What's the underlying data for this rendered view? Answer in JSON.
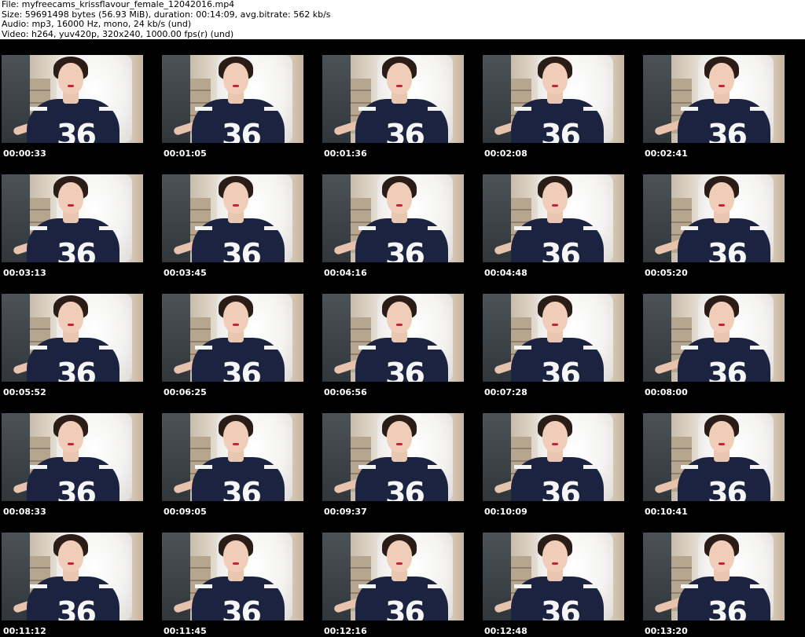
{
  "header": {
    "file": "File: myfreecams_krissflavour_female_12042016.mp4",
    "size": "Size: 59691498 bytes (56.93 MiB), duration: 00:14:09, avg.bitrate: 562 kb/s",
    "audio": "Audio: mp3, 16000 Hz, mono, 24 kb/s (und)",
    "video": "Video: h264, yuv420p, 320x240, 1000.00 fps(r) (und)"
  },
  "thumbnails": [
    {
      "timestamp": "00:00:33"
    },
    {
      "timestamp": "00:01:05"
    },
    {
      "timestamp": "00:01:36"
    },
    {
      "timestamp": "00:02:08"
    },
    {
      "timestamp": "00:02:41"
    },
    {
      "timestamp": "00:03:13"
    },
    {
      "timestamp": "00:03:45"
    },
    {
      "timestamp": "00:04:16"
    },
    {
      "timestamp": "00:04:48"
    },
    {
      "timestamp": "00:05:20"
    },
    {
      "timestamp": "00:05:52"
    },
    {
      "timestamp": "00:06:25"
    },
    {
      "timestamp": "00:06:56"
    },
    {
      "timestamp": "00:07:28"
    },
    {
      "timestamp": "00:08:00"
    },
    {
      "timestamp": "00:08:33"
    },
    {
      "timestamp": "00:09:05"
    },
    {
      "timestamp": "00:09:37"
    },
    {
      "timestamp": "00:10:09"
    },
    {
      "timestamp": "00:10:41"
    },
    {
      "timestamp": "00:11:12"
    },
    {
      "timestamp": "00:11:45"
    },
    {
      "timestamp": "00:12:16"
    },
    {
      "timestamp": "00:12:48"
    },
    {
      "timestamp": "00:13:20"
    }
  ],
  "jersey_number": "36",
  "colors": {
    "background": "#000000",
    "header_background": "#ffffff",
    "jersey": "#1b2340",
    "timestamp_text": "#ffffff"
  }
}
